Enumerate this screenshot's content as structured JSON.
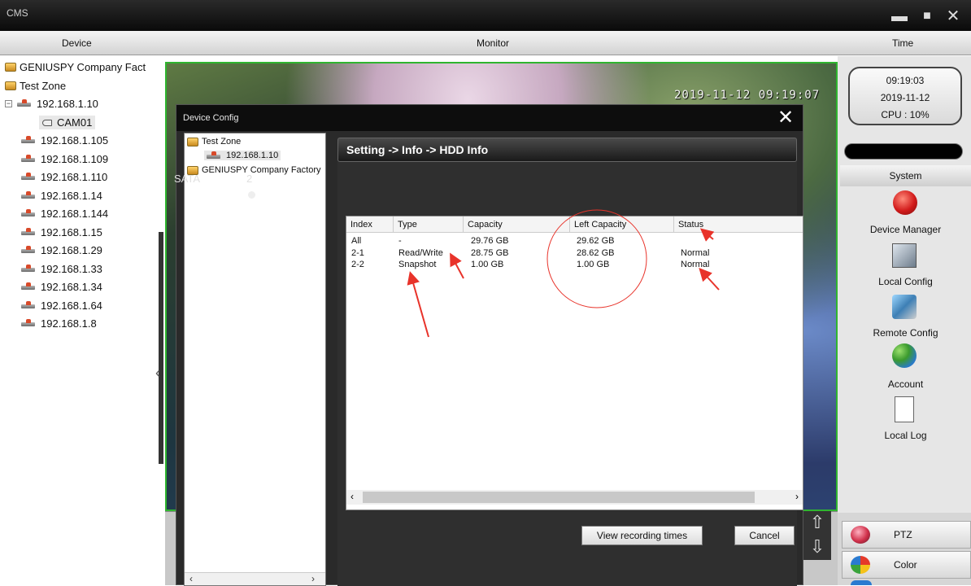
{
  "window": {
    "title": "CMS"
  },
  "headers": {
    "device": "Device",
    "monitor": "Monitor",
    "time": "Time"
  },
  "tree": {
    "items": [
      {
        "label": "GENIUSPY Company Fact"
      },
      {
        "label": "Test Zone"
      },
      {
        "label": "192.168.1.10"
      },
      {
        "label": "CAM01"
      },
      {
        "label": "192.168.1.105"
      },
      {
        "label": "192.168.1.109"
      },
      {
        "label": "192.168.1.110"
      },
      {
        "label": "192.168.1.14"
      },
      {
        "label": "192.168.1.144"
      },
      {
        "label": "192.168.1.15"
      },
      {
        "label": "192.168.1.29"
      },
      {
        "label": "192.168.1.33"
      },
      {
        "label": "192.168.1.34"
      },
      {
        "label": "192.168.1.64"
      },
      {
        "label": "192.168.1.8"
      }
    ]
  },
  "video": {
    "osd": "2019-11-12 09:19:07"
  },
  "dialog": {
    "title": "Device Config",
    "tree": [
      {
        "label": "Test Zone"
      },
      {
        "label": "192.168.1.10"
      },
      {
        "label": "GENIUSPY Company Factory"
      }
    ],
    "breadcrumb": "Setting -> Info -> HDD Info",
    "sata_label": "SATA",
    "sata_count": "2",
    "table": {
      "columns": [
        "Index",
        "Type",
        "Capacity",
        "Left Capacity",
        "Status"
      ],
      "rows": [
        [
          "All",
          "-",
          "29.76 GB",
          "29.62 GB",
          ""
        ],
        [
          "2-1",
          "Read/Write",
          "28.75 GB",
          "28.62 GB",
          "Normal"
        ],
        [
          "2-2",
          "Snapshot",
          "1.00 GB",
          "1.00 GB",
          "Normal"
        ]
      ]
    },
    "view_recording_label": "View recording times",
    "cancel_label": "Cancel"
  },
  "right": {
    "clock_time": "09:19:03",
    "clock_date": "2019-11-12",
    "cpu": "CPU : 10%",
    "system_header": "System",
    "menu": [
      {
        "label": "Device Manager",
        "icon": "device-manager-icon"
      },
      {
        "label": "Local Config",
        "icon": "local-config-icon"
      },
      {
        "label": "Remote Config",
        "icon": "remote-config-icon"
      },
      {
        "label": "Account",
        "icon": "account-icon"
      },
      {
        "label": "Local Log",
        "icon": "local-log-icon"
      }
    ],
    "ptz_label": "PTZ",
    "color_label": "Color"
  },
  "colors": {
    "video_border": "#2fb52f",
    "annotation": "#e8332a"
  }
}
